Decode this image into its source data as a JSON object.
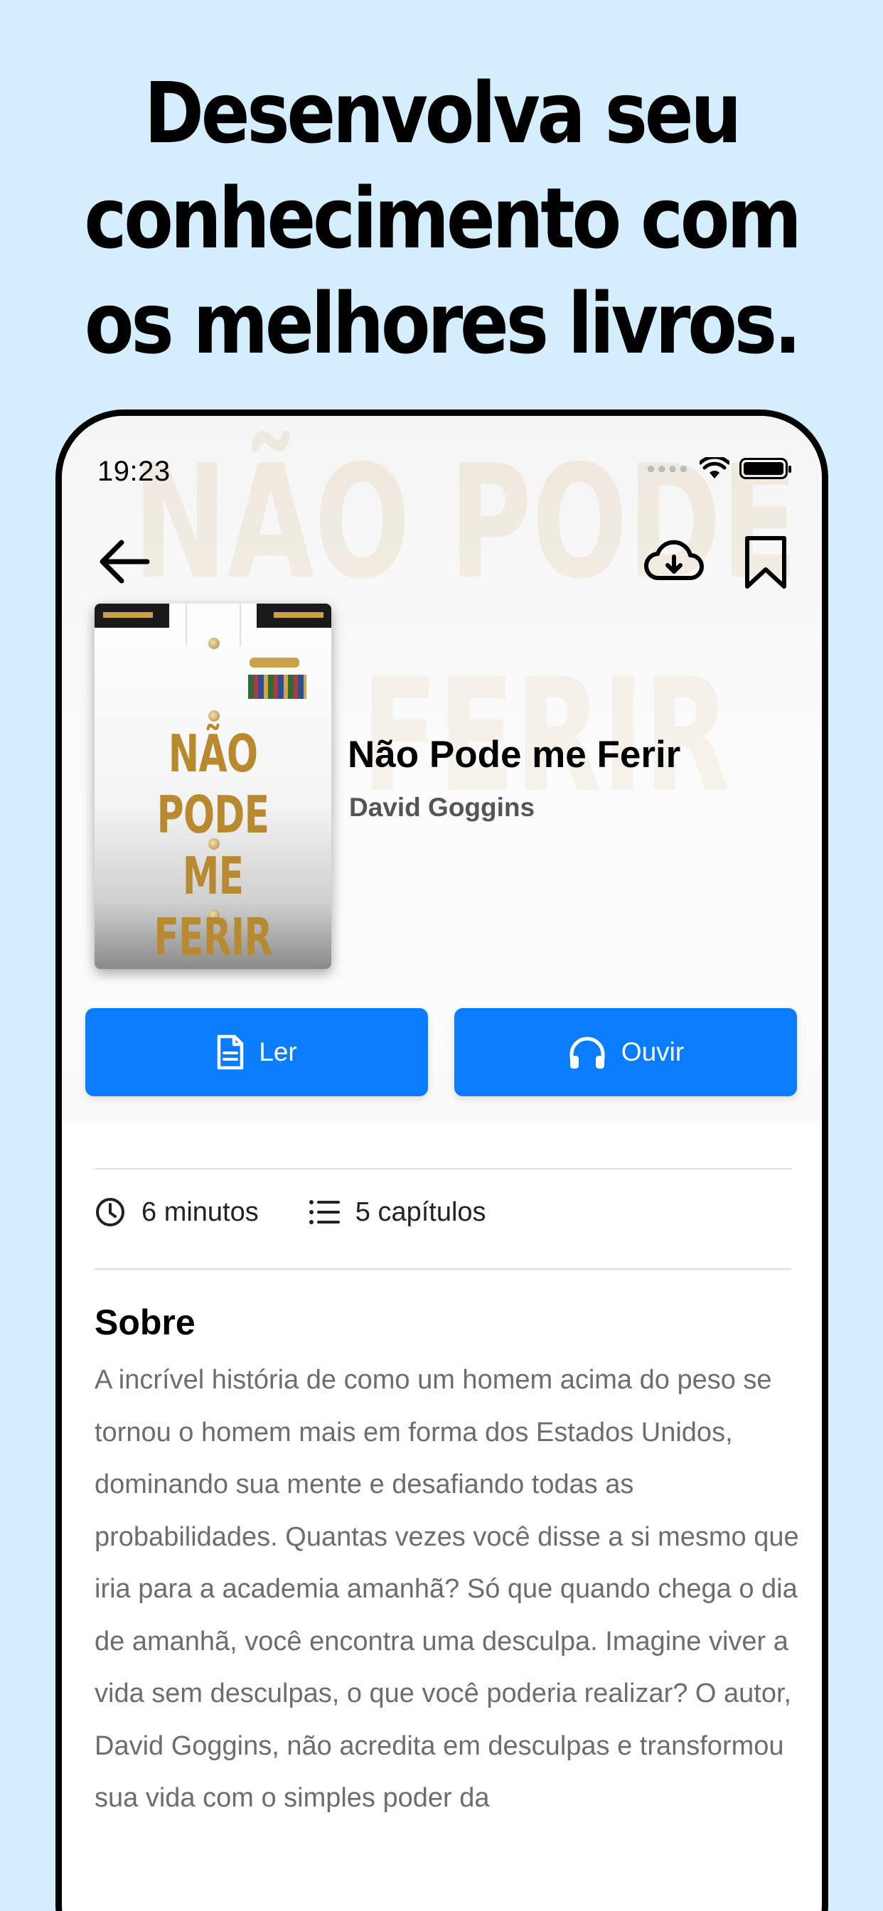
{
  "headline": {
    "line1": "Desenvolva seu",
    "line2": "conhecimento com",
    "line3": "os melhores livros."
  },
  "status_bar": {
    "time": "19:23"
  },
  "book": {
    "cover_title_line1": "NÃO PODE",
    "cover_title_line2": "ME FERIR",
    "title": "Não Pode me Ferir",
    "author": "David Goggins"
  },
  "actions": {
    "read_label": "Ler",
    "listen_label": "Ouvir"
  },
  "meta": {
    "duration": "6 minutos",
    "chapters": "5 capítulos"
  },
  "about": {
    "title": "Sobre",
    "text": "A incrível história de como um homem acima do peso se tornou o homem mais em forma dos Estados Unidos, dominando sua mente e desafiando todas as probabilidades. Quantas vezes você disse a si mesmo que iria para a academia amanhã? Só que quando chega o dia de amanhã, você encontra uma desculpa. Imagine viver a vida sem desculpas, o que você poderia realizar? O autor, David Goggins, não acredita em desculpas e transformou sua vida com o simples poder da"
  },
  "icons": {
    "back": "arrow-left-icon",
    "download": "cloud-download-icon",
    "bookmark": "bookmark-icon",
    "read": "document-icon",
    "listen": "headphones-icon",
    "duration": "clock-icon",
    "chapters": "list-icon"
  },
  "colors": {
    "page_background": "#d4eefd",
    "accent": "#0a7cff",
    "cover_gold": "#b8892f"
  }
}
